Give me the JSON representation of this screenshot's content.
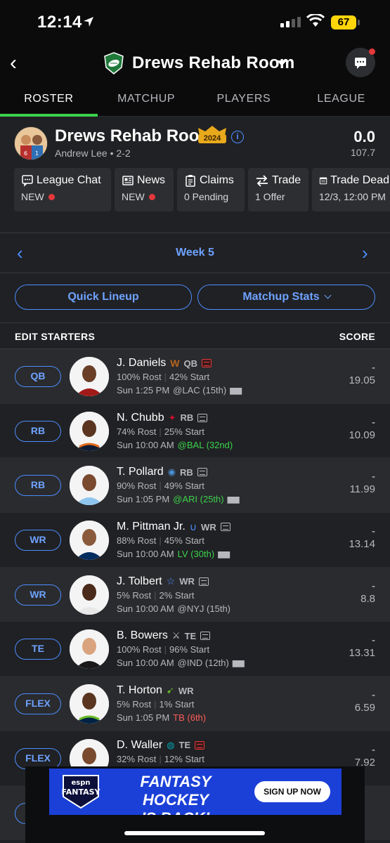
{
  "status_bar": {
    "time": "12:14",
    "battery": "67"
  },
  "header": {
    "title": "Drews Rehab Room"
  },
  "tabs": [
    {
      "label": "ROSTER",
      "active": true
    },
    {
      "label": "MATCHUP",
      "active": false
    },
    {
      "label": "PLAYERS",
      "active": false
    },
    {
      "label": "LEAGUE",
      "active": false
    }
  ],
  "team": {
    "name": "Drews Rehab Room",
    "badge_year": "2024",
    "owner_record": "Andrew Lee • 2-2",
    "score": "0.0",
    "projected": "107.7"
  },
  "quick_cards": [
    {
      "title": "League Chat",
      "sub": "NEW",
      "dot": true,
      "icon": "chat-icon"
    },
    {
      "title": "News",
      "sub": "NEW",
      "dot": true,
      "icon": "newspaper-icon"
    },
    {
      "title": "Claims",
      "sub": "0 Pending",
      "dot": false,
      "icon": "clipboard-icon"
    },
    {
      "title": "Trade",
      "sub": "1 Offer",
      "dot": false,
      "icon": "swap-icon"
    },
    {
      "title": "Trade Dead",
      "sub": "12/3, 12:00 PM",
      "dot": false,
      "icon": "calendar-icon"
    }
  ],
  "week": {
    "label": "Week 5"
  },
  "buttons": {
    "quick_lineup": "Quick Lineup",
    "matchup_stats": "Matchup Stats"
  },
  "list": {
    "left_header": "EDIT STARTERS",
    "right_header": "SCORE"
  },
  "colors": {
    "accent_blue": "#4c8dff",
    "active_tab_green": "#3bd24c",
    "alert_red": "#e5383b"
  },
  "players": [
    {
      "slot": "QB",
      "name": "J. Daniels",
      "team_icon": "commanders-logo-icon",
      "pos": "QB",
      "news_red": true,
      "rost": "100% Rost",
      "start": "42% Start",
      "time": "Sun 1:25 PM",
      "opp": "@LAC (15th)",
      "opp_color": "",
      "weather": true,
      "score": "-",
      "proj": "19.05"
    },
    {
      "slot": "RB",
      "name": "N. Chubb",
      "team_icon": "texans-logo-icon",
      "pos": "RB",
      "news_red": false,
      "rost": "74% Rost",
      "start": "25% Start",
      "time": "Sun 10:00 AM",
      "opp": "@BAL (32nd)",
      "opp_color": "good",
      "weather": false,
      "score": "-",
      "proj": "10.09"
    },
    {
      "slot": "RB",
      "name": "T. Pollard",
      "team_icon": "titans-logo-icon",
      "pos": "RB",
      "news_red": false,
      "rost": "90% Rost",
      "start": "49% Start",
      "time": "Sun 1:05 PM",
      "opp": "@ARI (25th)",
      "opp_color": "good",
      "weather": true,
      "score": "-",
      "proj": "11.99"
    },
    {
      "slot": "WR",
      "name": "M. Pittman Jr.",
      "team_icon": "colts-logo-icon",
      "pos": "WR",
      "news_red": false,
      "rost": "88% Rost",
      "start": "45% Start",
      "time": "Sun 10:00 AM",
      "opp": "LV (30th)",
      "opp_color": "good",
      "weather": true,
      "score": "-",
      "proj": "13.14"
    },
    {
      "slot": "WR",
      "name": "J. Tolbert",
      "team_icon": "cowboys-logo-icon",
      "pos": "WR",
      "news_red": false,
      "rost": "5% Rost",
      "start": "2% Start",
      "time": "Sun 10:00 AM",
      "opp": "@NYJ (15th)",
      "opp_color": "",
      "weather": false,
      "score": "-",
      "proj": "8.8"
    },
    {
      "slot": "TE",
      "name": "B. Bowers",
      "team_icon": "raiders-logo-icon",
      "pos": "TE",
      "news_red": false,
      "rost": "100% Rost",
      "start": "96% Start",
      "time": "Sun 10:00 AM",
      "opp": "@IND (12th)",
      "opp_color": "",
      "weather": true,
      "score": "-",
      "proj": "13.31"
    },
    {
      "slot": "FLEX",
      "name": "T. Horton",
      "team_icon": "seahawks-logo-icon",
      "pos": "WR",
      "news_red": false,
      "news": false,
      "rost": "5% Rost",
      "start": "1% Start",
      "time": "Sun 1:05 PM",
      "opp": "TB (6th)",
      "opp_color": "bad",
      "weather": false,
      "score": "-",
      "proj": "6.59"
    },
    {
      "slot": "FLEX",
      "name": "D. Waller",
      "team_icon": "dolphins-logo-icon",
      "pos": "TE",
      "news_red": true,
      "rost": "32% Rost",
      "start": "12% Start",
      "time": "",
      "opp": "",
      "opp_color": "",
      "weather": false,
      "score": "-",
      "proj": "7.92"
    }
  ],
  "ad": {
    "brand_top": "espn",
    "brand": "FANTASY",
    "headline_1": "FANTASY HOCKEY",
    "headline_2": "IS BACK!",
    "cta": "SIGN UP NOW"
  }
}
